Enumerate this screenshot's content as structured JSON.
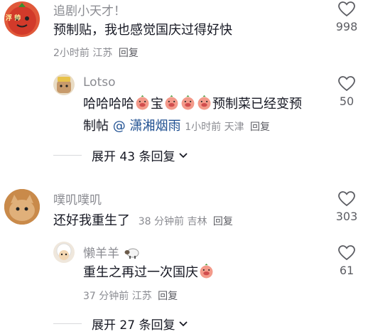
{
  "comments": [
    {
      "username": "追剧小天才！",
      "text": "预制贴，我也感觉国庆过得好快",
      "time": "2小时前",
      "location": "江苏",
      "reply_label": "回复",
      "likes": "998"
    },
    {
      "username": "Lotso",
      "text_line1_a": "哈哈哈哈",
      "text_line1_b": "宝",
      "text_line1_c": "预制菜已经变预",
      "text_line2": "制帖",
      "mention": "@ 潇湘烟雨",
      "time": "1小时前",
      "location": "天津",
      "reply_label": "回复",
      "likes": "50"
    },
    {
      "expand_label": "展开 43 条回复"
    },
    {
      "username": "噗叽噗叽",
      "text": "还好我重生了",
      "time": "38 分钟前",
      "location": "吉林",
      "reply_label": "回复",
      "likes": "303"
    },
    {
      "username": "懒羊羊",
      "text": "重生之再过一次国庆",
      "time": "37 分钟前",
      "location": "江苏",
      "reply_label": "回复",
      "likes": "61"
    },
    {
      "expand_label": "展开 27 条回复"
    }
  ],
  "avatar0_text": "浮 帅"
}
